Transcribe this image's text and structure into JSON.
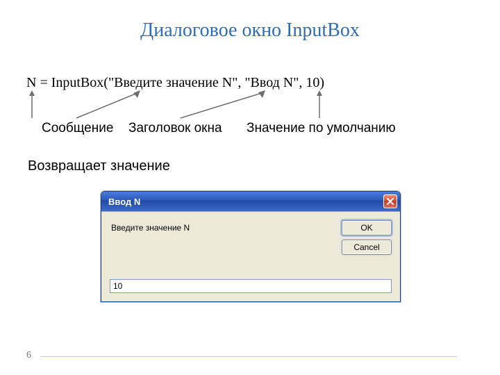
{
  "title": "Диалоговое окно InputBox",
  "code_line": "N = InputBox(\"Введите значение N\", \"Ввод N\", 10)",
  "labels": {
    "message": "Сообщение",
    "window_title": "Заголовок окна",
    "default_value": "Значение по умолчанию"
  },
  "return_line": "Возвращает значение",
  "dialog": {
    "title": "Ввод N",
    "prompt": "Введите значение N",
    "ok": "OK",
    "cancel": "Cancel",
    "input_value": "10"
  },
  "page_number": "6"
}
